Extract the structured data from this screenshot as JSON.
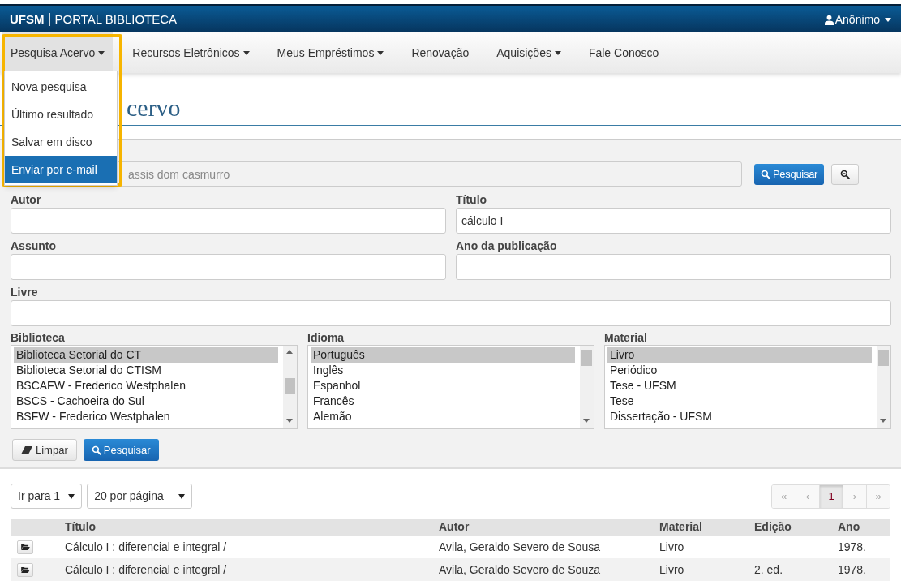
{
  "header": {
    "brand": "UFSM",
    "title": "PORTAL BIBLIOTECA",
    "user": "Anônimo"
  },
  "nav": [
    {
      "label": "Pesquisa Acervo",
      "dropdown": true,
      "open": true
    },
    {
      "label": "Recursos Eletrônicos",
      "dropdown": true,
      "open": false
    },
    {
      "label": "Meus Empréstimos",
      "dropdown": true,
      "open": false
    },
    {
      "label": "Renovação",
      "dropdown": false,
      "open": false
    },
    {
      "label": "Aquisições",
      "dropdown": true,
      "open": false
    },
    {
      "label": "Fale Conosco",
      "dropdown": false,
      "open": false
    }
  ],
  "dropdown_menu": [
    {
      "label": "Nova pesquisa",
      "selected": false
    },
    {
      "label": "Último resultado",
      "selected": false
    },
    {
      "label": "Salvar em disco",
      "selected": false
    },
    {
      "label": "Enviar por e-mail",
      "selected": true
    }
  ],
  "page_heading": "cervo",
  "quick_search": {
    "placeholder": "assis dom casmurro",
    "button": "Pesquisar"
  },
  "fields": [
    {
      "label": "Autor"
    },
    {
      "label": "Título",
      "value": "cálculo I"
    },
    {
      "label": "Assunto"
    },
    {
      "label": "Ano da publicação"
    },
    {
      "label": "Livre"
    }
  ],
  "listboxes": [
    {
      "label": "Biblioteca",
      "options": [
        {
          "label": "Biblioteca Setorial do CT",
          "selected": true
        },
        {
          "label": "Biblioteca Setorial do CTISM",
          "selected": false
        },
        {
          "label": "BSCAFW - Frederico Westphalen",
          "selected": false
        },
        {
          "label": "BSCS - Cachoeira do Sul",
          "selected": false
        },
        {
          "label": "BSFW - Frederico Westphalen",
          "selected": false
        }
      ]
    },
    {
      "label": "Idioma",
      "options": [
        {
          "label": "Português",
          "selected": true
        },
        {
          "label": "Inglês",
          "selected": false
        },
        {
          "label": "Espanhol",
          "selected": false
        },
        {
          "label": "Francês",
          "selected": false
        },
        {
          "label": "Alemão",
          "selected": false
        }
      ]
    },
    {
      "label": "Material",
      "options": [
        {
          "label": "Livro",
          "selected": true
        },
        {
          "label": "Periódico",
          "selected": false
        },
        {
          "label": "Tese - UFSM",
          "selected": false
        },
        {
          "label": "Tese",
          "selected": false
        },
        {
          "label": "Dissertação - UFSM",
          "selected": false
        }
      ]
    }
  ],
  "form_buttons": [
    {
      "kind": "clear",
      "label": "Limpar"
    },
    {
      "kind": "search",
      "label": "Pesquisar"
    }
  ],
  "results": {
    "goto": "Ir para 1",
    "per_page": "20 por página",
    "pagination": [
      {
        "label": "«",
        "selected": false,
        "disabled": true
      },
      {
        "label": "‹",
        "selected": false,
        "disabled": true
      },
      {
        "label": "1",
        "selected": true,
        "disabled": false
      },
      {
        "label": "›",
        "selected": false,
        "disabled": true
      },
      {
        "label": "»",
        "selected": false,
        "disabled": true
      }
    ],
    "columns": [
      "Título",
      "Autor",
      "Material",
      "Edição",
      "Ano"
    ],
    "rows": [
      [
        "Cálculo I : diferencial e integral /",
        "Avila, Geraldo Severo de Sousa",
        "Livro",
        "",
        "1978."
      ],
      [
        "Cálculo I : diferencial e integral /",
        "Avila, Geraldo Severo de Souza",
        "Livro",
        "2. ed.",
        "1978."
      ]
    ]
  }
}
